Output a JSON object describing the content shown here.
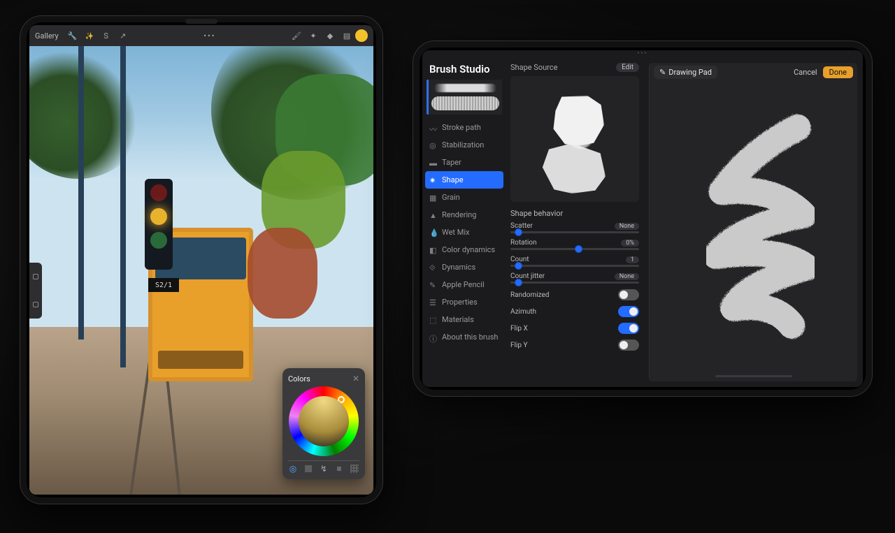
{
  "left": {
    "topbar": {
      "gallery": "Gallery",
      "sign": "S2/1"
    },
    "colors": {
      "title": "Colors"
    }
  },
  "right": {
    "title": "Brush Studio",
    "sidebar": {
      "items": [
        {
          "label": "Stroke path"
        },
        {
          "label": "Stabilization"
        },
        {
          "label": "Taper"
        },
        {
          "label": "Shape"
        },
        {
          "label": "Grain"
        },
        {
          "label": "Rendering"
        },
        {
          "label": "Wet Mix"
        },
        {
          "label": "Color dynamics"
        },
        {
          "label": "Dynamics"
        },
        {
          "label": "Apple Pencil"
        },
        {
          "label": "Properties"
        },
        {
          "label": "Materials"
        },
        {
          "label": "About this brush"
        }
      ]
    },
    "center": {
      "shape_source": "Shape Source",
      "edit": "Edit",
      "behavior_title": "Shape behavior",
      "sliders": {
        "scatter": {
          "label": "Scatter",
          "value": "None",
          "pos": 3
        },
        "rotation": {
          "label": "Rotation",
          "value": "0%",
          "pos": 50
        },
        "count": {
          "label": "Count",
          "value": "1",
          "pos": 3
        },
        "count_jitter": {
          "label": "Count jitter",
          "value": "None",
          "pos": 3
        }
      },
      "toggles": {
        "randomized": {
          "label": "Randomized",
          "on": false
        },
        "azimuth": {
          "label": "Azimuth",
          "on": true
        },
        "flipx": {
          "label": "Flip X",
          "on": true
        },
        "flipy": {
          "label": "Flip Y",
          "on": false
        }
      }
    },
    "canvas": {
      "drawing_pad": "Drawing Pad",
      "cancel": "Cancel",
      "done": "Done"
    }
  }
}
